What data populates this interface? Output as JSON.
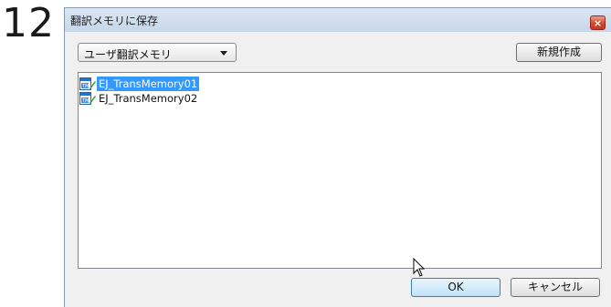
{
  "step_number": "12",
  "window": {
    "title": "翻訳メモリに保存",
    "close_symbol": "×"
  },
  "memory_select": {
    "selected": "ユーザ翻訳メモリ"
  },
  "toolbar": {
    "new_label": "新規作成"
  },
  "memory_list": {
    "items": [
      {
        "label": "EJ_TransMemory01",
        "selected": true,
        "icon": "translation-memory-icon"
      },
      {
        "label": "EJ_TransMemory02",
        "selected": false,
        "icon": "translation-memory-icon"
      }
    ]
  },
  "buttons": {
    "ok_label": "OK",
    "cancel_label": "キャンセル"
  },
  "colors": {
    "selection": "#3399ff",
    "close_button": "#d3472c",
    "titlebar": "#dbe6f3"
  }
}
